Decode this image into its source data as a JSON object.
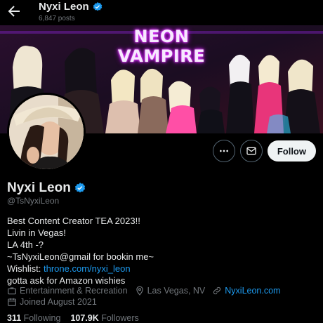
{
  "header": {
    "name": "Nyxi Leon",
    "post_count": "6,847 posts"
  },
  "banner": {
    "title": "NEON VAMPIRE"
  },
  "actions": {
    "follow_label": "Follow"
  },
  "profile": {
    "name": "Nyxi Leon",
    "handle": "@TsNyxiLeon"
  },
  "bio": {
    "line1": "Best Content Creator TEA 2023!!",
    "line2": "Livin in Vegas!",
    "line3": "LA 4th -?",
    "line4": "~TsNyxiLeon@gmail for bookin me~",
    "line5_prefix": "Wishlist: ",
    "line5_link": "throne.com/nyxi_leon",
    "line6": "gotta ask for Amazon wishies"
  },
  "meta": {
    "category": "Entertainment & Recreation",
    "location": "Las Vegas, NV",
    "website": "NyxiLeon.com",
    "joined": "Joined August 2021"
  },
  "stats": {
    "following_count": "311",
    "following_label": "Following",
    "followers_count": "107.9K",
    "followers_label": "Followers"
  },
  "colors": {
    "accent": "#1d9bf0",
    "background": "#000000",
    "secondary_text": "#71767b"
  }
}
